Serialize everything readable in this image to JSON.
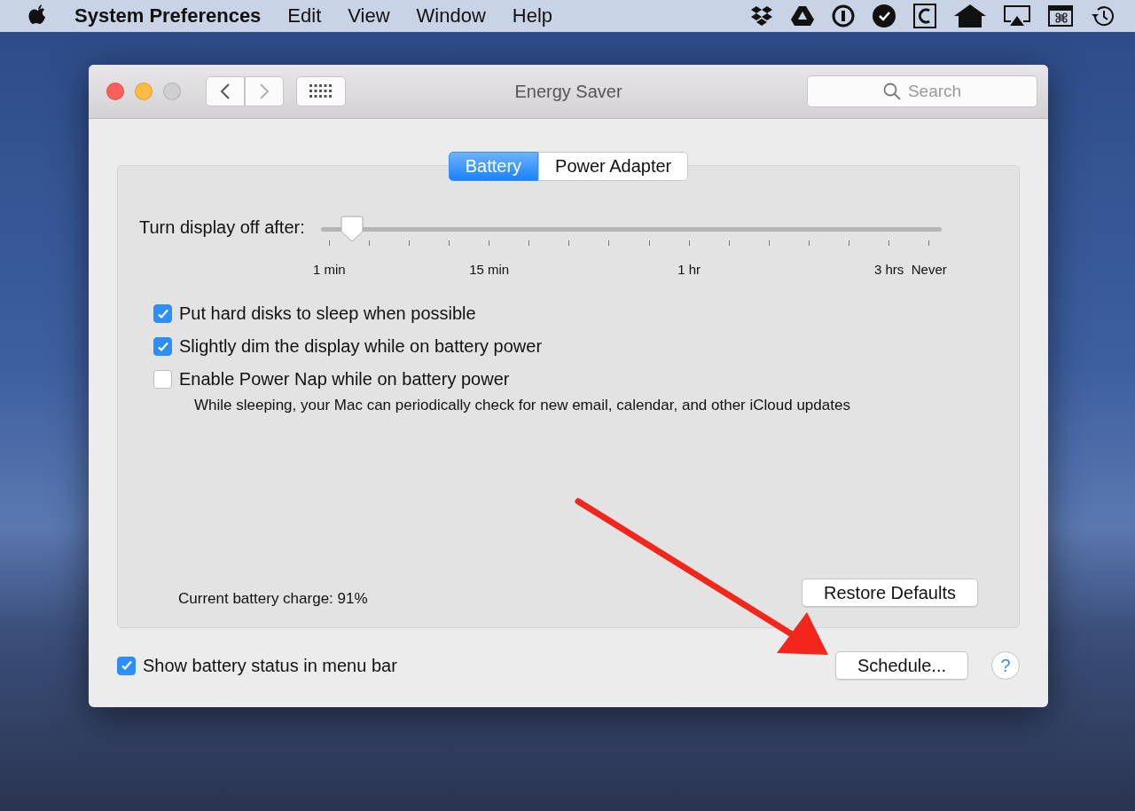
{
  "menu_bar": {
    "app_name": "System Preferences",
    "menus": [
      "Edit",
      "View",
      "Window",
      "Help"
    ]
  },
  "window": {
    "title": "Energy Saver",
    "search": {
      "placeholder": "Search"
    }
  },
  "tabs": [
    {
      "label": "Battery",
      "selected": true
    },
    {
      "label": "Power Adapter",
      "selected": false
    }
  ],
  "display_slider": {
    "label": "Turn display off after:",
    "level": 0.05,
    "ticks": [
      {
        "kind": "labeled",
        "label": "1 min"
      },
      {
        "kind": "plain"
      },
      {
        "kind": "plain"
      },
      {
        "kind": "plain"
      },
      {
        "kind": "labeled",
        "label": "15 min"
      },
      {
        "kind": "plain"
      },
      {
        "kind": "plain"
      },
      {
        "kind": "plain"
      },
      {
        "kind": "plain"
      },
      {
        "kind": "labeled",
        "label": "1 hr"
      },
      {
        "kind": "plain"
      },
      {
        "kind": "plain"
      },
      {
        "kind": "plain"
      },
      {
        "kind": "plain"
      },
      {
        "kind": "labeled",
        "label": "3 hrs"
      },
      {
        "kind": "labeled",
        "label": "Never"
      }
    ]
  },
  "options": [
    {
      "label": "Put hard disks to sleep when possible",
      "checked": true
    },
    {
      "label": "Slightly dim the display while on battery power",
      "checked": true
    },
    {
      "label": "Enable Power Nap while on battery power",
      "checked": false,
      "note": "While sleeping, your Mac can periodically check for new email, calendar, and other iCloud updates"
    }
  ],
  "battery_charge": "Current battery charge: 91%",
  "restore_button": "Restore Defaults",
  "show_status": {
    "label": "Show battery status in menu bar",
    "checked": true
  },
  "schedule_button": "Schedule...",
  "help_button": "?"
}
